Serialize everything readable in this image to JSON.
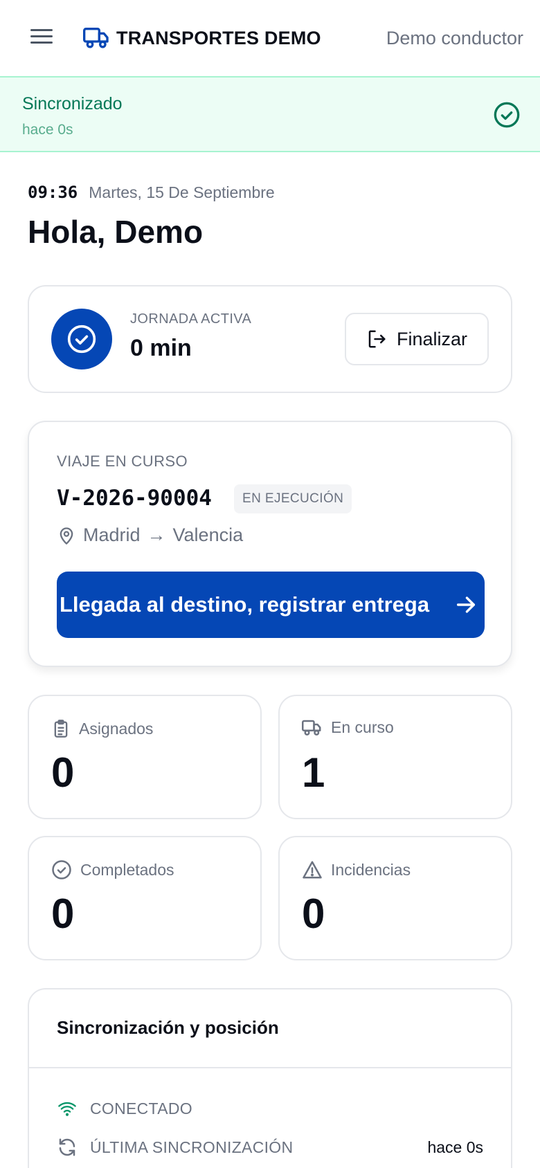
{
  "header": {
    "brand": "TRANSPORTES DEMO",
    "user": "Demo conductor"
  },
  "sync_banner": {
    "status": "Sincronizado",
    "ago": "hace 0s"
  },
  "clock": {
    "time": "09:36",
    "date": "Martes, 15 De Septiembre"
  },
  "greeting": "Hola, Demo",
  "shift": {
    "label": "JORNADA ACTIVA",
    "value": "0 min",
    "finish_label": "Finalizar"
  },
  "trip": {
    "label": "VIAJE EN CURSO",
    "code": "V-2026-90004",
    "status": "EN EJECUCIÓN",
    "origin": "Madrid",
    "arrow": "→",
    "destination": "Valencia",
    "action_label": "Llegada al destino, registrar entrega"
  },
  "stats": [
    {
      "label": "Asignados",
      "value": "0",
      "icon": "clipboard-icon"
    },
    {
      "label": "En curso",
      "value": "1",
      "icon": "truck-icon"
    },
    {
      "label": "Completados",
      "value": "0",
      "icon": "check-circle-icon"
    },
    {
      "label": "Incidencias",
      "value": "0",
      "icon": "warning-icon"
    }
  ],
  "sync_panel": {
    "title": "Sincronización y posición",
    "rows": [
      {
        "key": "CONECTADO",
        "value": "",
        "icon": "wifi-icon"
      },
      {
        "key": "ÚLTIMA SINCRONIZACIÓN",
        "value": "hace 0s",
        "icon": "refresh-icon"
      }
    ]
  },
  "colors": {
    "primary": "#0547b5",
    "success": "#047857",
    "success_bg": "#ecfdf5",
    "muted": "#6b7280"
  }
}
